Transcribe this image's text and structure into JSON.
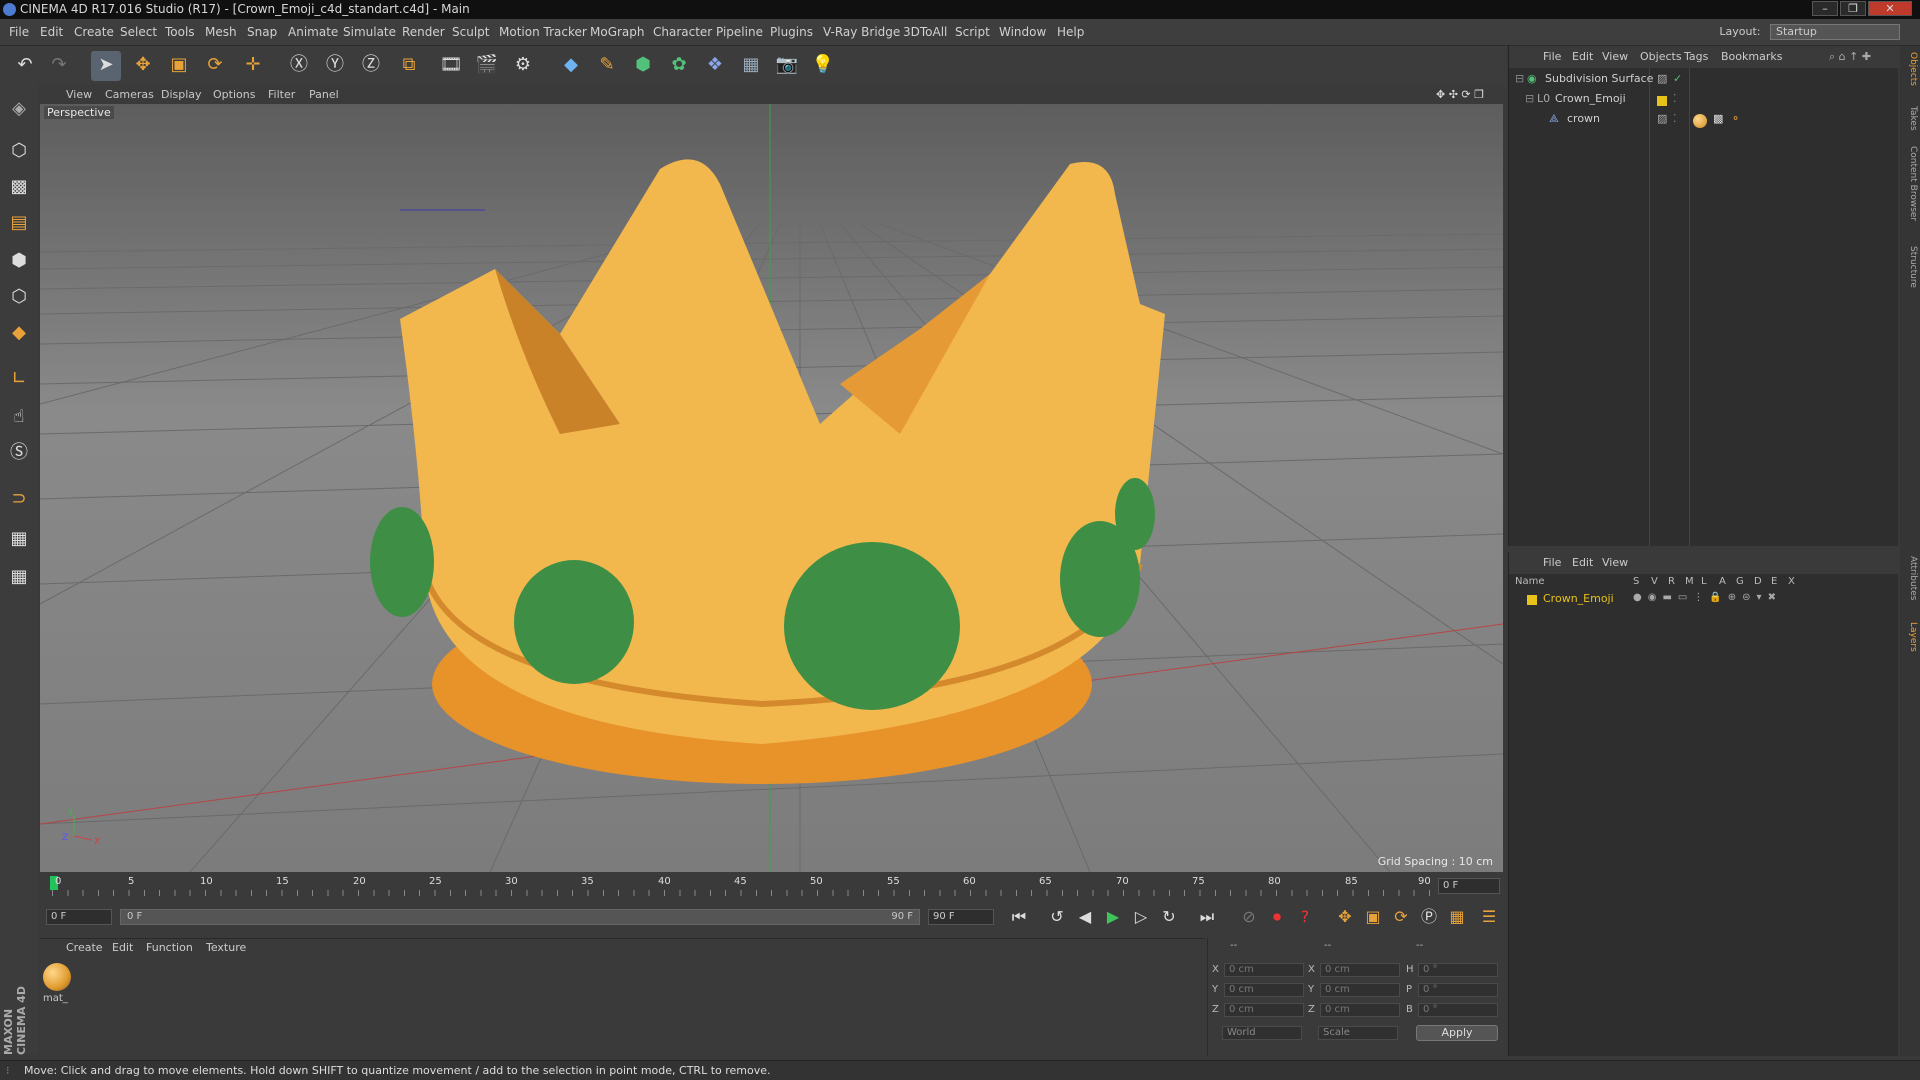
{
  "titlebar": {
    "title": "CINEMA 4D R17.016 Studio (R17) - [Crown_Emoji_c4d_standart.c4d] - Main"
  },
  "menubar": {
    "items": [
      "File",
      "Edit",
      "Create",
      "Select",
      "Tools",
      "Mesh",
      "Snap",
      "Animate",
      "Simulate",
      "Render",
      "Sculpt",
      "Motion Tracker",
      "MoGraph",
      "Character",
      "Pipeline",
      "Plugins",
      "V-Ray Bridge",
      "3DToAll",
      "Script",
      "Window",
      "Help"
    ],
    "layout_label": "Layout:",
    "layout_value": "Startup"
  },
  "viewport": {
    "menu": [
      "View",
      "Cameras",
      "Display",
      "Options",
      "Filter",
      "Panel"
    ],
    "label": "Perspective",
    "grid_spacing": "Grid Spacing : 10 cm"
  },
  "timeline": {
    "ticks": [
      "0",
      "5",
      "10",
      "15",
      "20",
      "25",
      "30",
      "35",
      "40",
      "45",
      "50",
      "55",
      "60",
      "65",
      "70",
      "75",
      "80",
      "85",
      "90"
    ],
    "end_field": "0 F"
  },
  "playback": {
    "start": "0 F",
    "range_start": "0 F",
    "range_end": "90 F",
    "end": "90 F"
  },
  "material_manager": {
    "menu": [
      "Create",
      "Edit",
      "Function",
      "Texture"
    ],
    "materials": [
      {
        "name": "mat_"
      }
    ]
  },
  "coordinates": {
    "headers": [
      "--",
      "--",
      "--"
    ],
    "rows": [
      {
        "a": "X",
        "av": "0 cm",
        "b": "X",
        "bv": "0 cm",
        "c": "H",
        "cv": "0 °"
      },
      {
        "a": "Y",
        "av": "0 cm",
        "b": "Y",
        "bv": "0 cm",
        "c": "P",
        "cv": "0 °"
      },
      {
        "a": "Z",
        "av": "0 cm",
        "b": "Z",
        "bv": "0 cm",
        "c": "B",
        "cv": "0 °"
      }
    ],
    "mode": "World",
    "scale": "Scale",
    "apply": "Apply"
  },
  "object_manager": {
    "menu": [
      "File",
      "Edit",
      "View",
      "Objects",
      "Tags",
      "Bookmarks"
    ],
    "objects": [
      {
        "name": "Subdivision Surface"
      },
      {
        "name": "Crown_Emoji"
      },
      {
        "name": "crown"
      }
    ]
  },
  "layer_manager": {
    "menu": [
      "File",
      "Edit",
      "View"
    ],
    "name_header": "Name",
    "flag_headers": [
      "S",
      "V",
      "R",
      "M",
      "L",
      "A",
      "G",
      "D",
      "E",
      "X"
    ],
    "layers": [
      {
        "name": "Crown_Emoji"
      }
    ]
  },
  "right_tabs": [
    "Objects",
    "Takes",
    "Content Browser",
    "Structure",
    "Attributes",
    "Layers"
  ],
  "status": "Move: Click and drag to move elements. Hold down SHIFT to quantize movement / add to the selection in point mode, CTRL to remove.",
  "logo": "MAXON CINEMA 4D",
  "colors": {
    "accent": "#e8a23a",
    "crown": "#f2b84e",
    "gem": "#3e8f45",
    "layer": "#e6c21a"
  }
}
